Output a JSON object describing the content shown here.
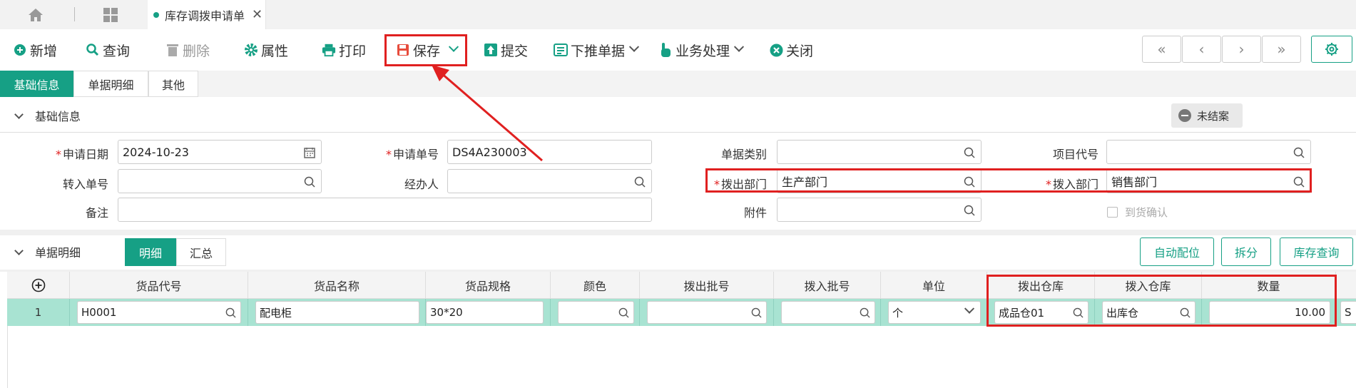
{
  "tabs": {
    "doc_tab_label": "库存调拨申请单"
  },
  "toolbar": {
    "new": "新增",
    "query": "查询",
    "delete": "删除",
    "properties": "属性",
    "print": "打印",
    "save": "保存",
    "submit": "提交",
    "push_down": "下推单据",
    "business": "业务处理",
    "close": "关闭"
  },
  "subtabs": [
    "基础信息",
    "单据明细",
    "其他"
  ],
  "basic_section": {
    "title": "基础信息",
    "status": "未结案"
  },
  "form": {
    "apply_date_label": "申请日期",
    "apply_date": "2024-10-23",
    "apply_no_label": "申请单号",
    "apply_no": "DS4A230003",
    "doc_type_label": "单据类别",
    "project_code_label": "项目代号",
    "transfer_in_no_label": "转入单号",
    "handler_label": "经办人",
    "out_dept_label": "拨出部门",
    "out_dept": "生产部门",
    "in_dept_label": "拨入部门",
    "in_dept": "销售部门",
    "remark_label": "备注",
    "attachment_label": "附件",
    "arrival_confirm_label": "到货确认"
  },
  "detail_section": {
    "title": "单据明细",
    "seg_detail": "明细",
    "seg_summary": "汇总",
    "auto_alloc": "自动配位",
    "split": "拆分",
    "stock_query": "库存查询"
  },
  "grid": {
    "headers": [
      "货品代号",
      "货品名称",
      "货品规格",
      "颜色",
      "拨出批号",
      "拨入批号",
      "单位",
      "拨出仓库",
      "拨入仓库",
      "数量"
    ],
    "rows": [
      {
        "index": "1",
        "code": "H0001",
        "name": "配电柜",
        "spec": "30*20",
        "color": "",
        "out_batch": "",
        "in_batch": "",
        "unit": "个",
        "out_wh": "成品仓01",
        "in_wh": "出库仓",
        "qty": "10.00",
        "overflow": "S"
      }
    ]
  },
  "colors": {
    "accent": "#16a085",
    "highlight": "#e02020",
    "row_selected": "#a8e3d2"
  }
}
